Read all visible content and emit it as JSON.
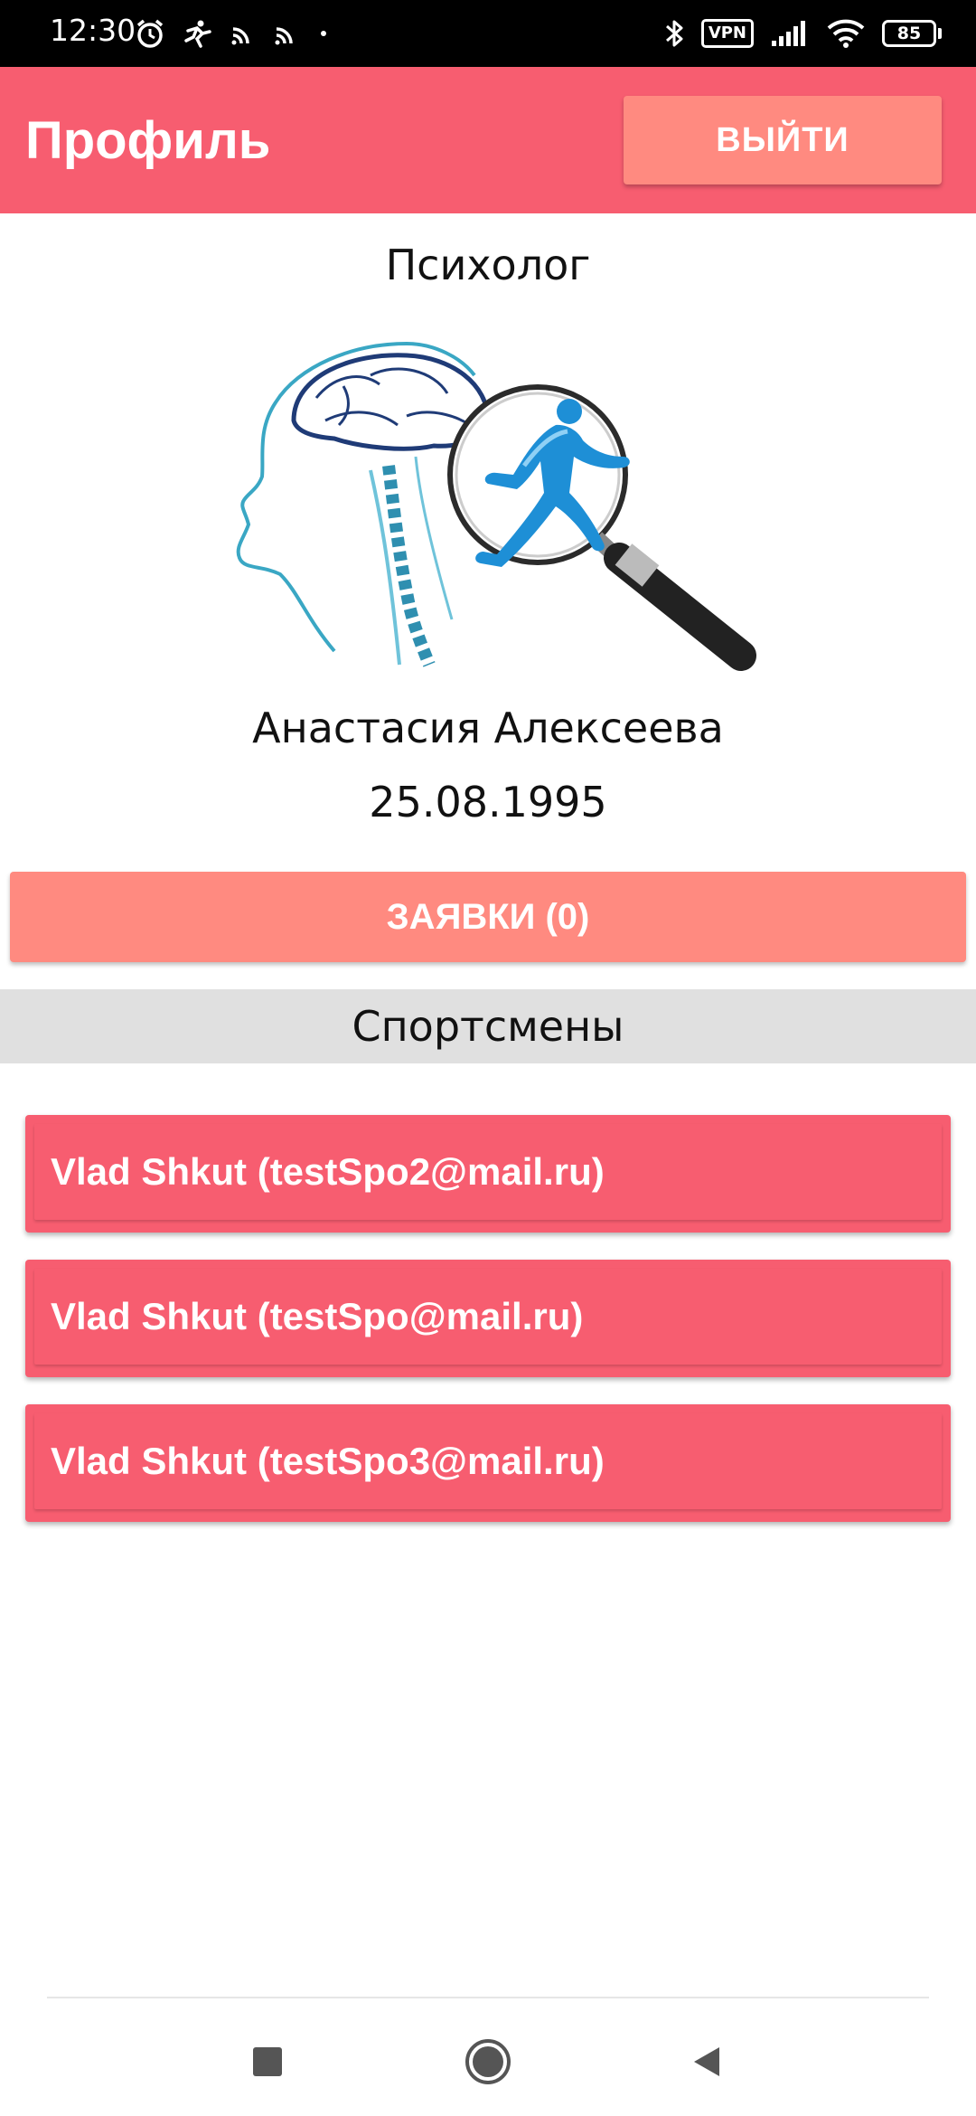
{
  "status_bar": {
    "time": "12:30",
    "vpn": "VPN",
    "battery": "85"
  },
  "app_bar": {
    "title": "Профиль",
    "logout_label": "ВЫЙТИ"
  },
  "profile": {
    "role": "Психолог",
    "name": "Анастасия Алексеева",
    "birth_date": "25.08.1995"
  },
  "requests_button": "ЗАЯВКИ (0)",
  "athletes": {
    "header": "Спортсмены",
    "items": [
      {
        "label": "Vlad Shkut (testSpo2@mail.ru)"
      },
      {
        "label": "Vlad Shkut (testSpo@mail.ru)"
      },
      {
        "label": "Vlad Shkut (testSpo3@mail.ru)"
      }
    ]
  },
  "colors": {
    "primary": "#f75d70",
    "accent": "#ff8a80",
    "section_bg": "#e0e0e0"
  },
  "icons": {
    "nav": [
      "recents-square-icon",
      "home-circle-icon",
      "back-triangle-icon"
    ]
  }
}
